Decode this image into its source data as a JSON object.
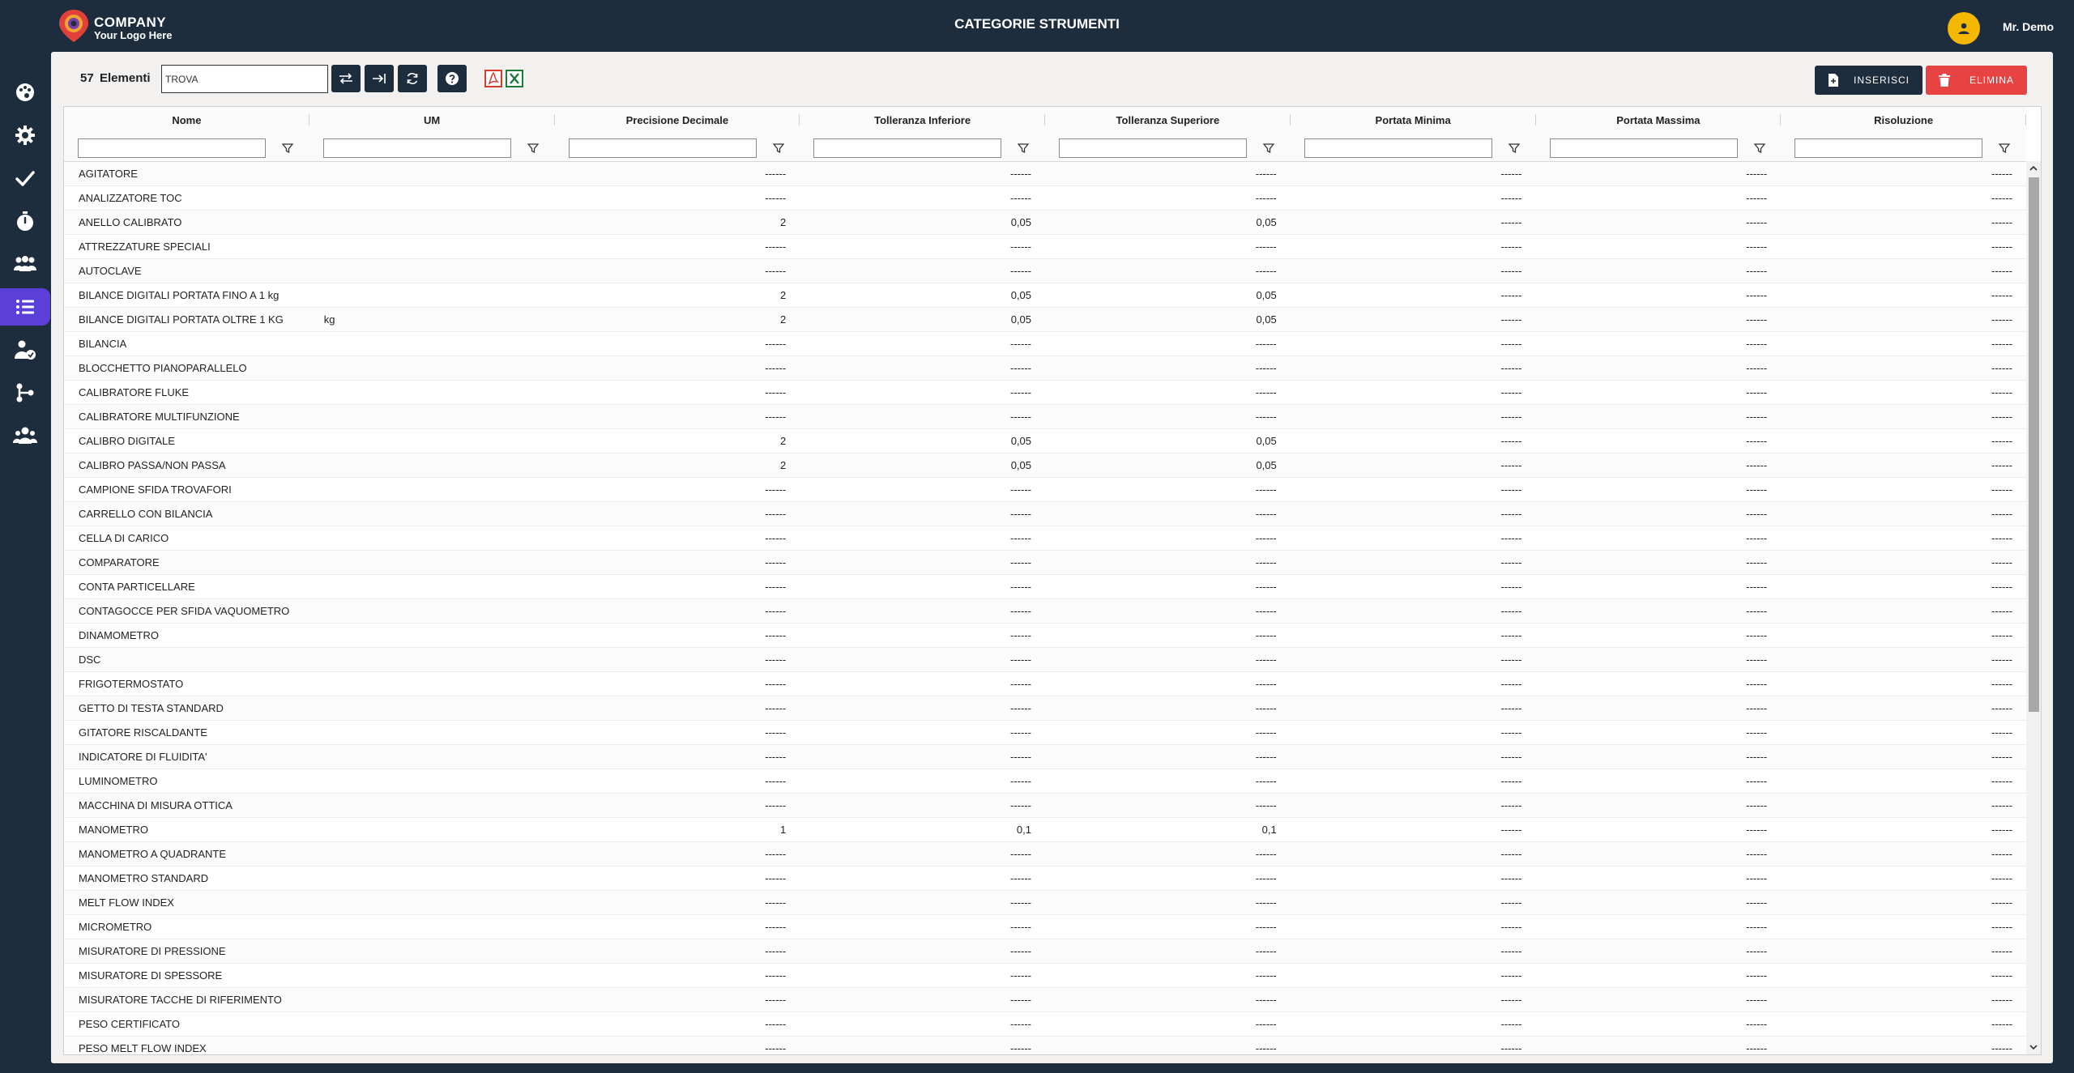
{
  "header": {
    "company": "COMPANY",
    "tagline": "Your Logo Here",
    "title": "CATEGORIE STRUMENTI",
    "user_name": "Mr. Demo"
  },
  "sidebar": {
    "items": [
      {
        "name": "palette-icon"
      },
      {
        "name": "gear-icon"
      },
      {
        "name": "check-icon"
      },
      {
        "name": "stopwatch-icon"
      },
      {
        "name": "users-group-icon"
      },
      {
        "name": "list-icon",
        "active": true
      },
      {
        "name": "user-check-icon"
      },
      {
        "name": "branch-icon"
      },
      {
        "name": "team-icon"
      }
    ]
  },
  "toolbar": {
    "count": "57",
    "count_label": "Elementi",
    "search_value": "TROVA",
    "insert_label": "INSERISCI",
    "delete_label": "ELIMINA"
  },
  "colors": {
    "navy": "#1e2d3d",
    "accent": "#5b3fd9",
    "danger": "#e84343",
    "avatar": "#f5b800"
  },
  "table": {
    "columns": [
      "Nome",
      "UM",
      "Precisione Decimale",
      "Tolleranza Inferiore",
      "Tolleranza Superiore",
      "Portata Minima",
      "Portata Massima",
      "Risoluzione"
    ],
    "rows": [
      [
        "AGITATORE",
        "",
        "------",
        "------",
        "------",
        "------",
        "------",
        "------"
      ],
      [
        "ANALIZZATORE TOC",
        "",
        "------",
        "------",
        "------",
        "------",
        "------",
        "------"
      ],
      [
        "ANELLO CALIBRATO",
        "",
        "2",
        "0,05",
        "0,05",
        "------",
        "------",
        "------"
      ],
      [
        "ATTREZZATURE SPECIALI",
        "",
        "------",
        "------",
        "------",
        "------",
        "------",
        "------"
      ],
      [
        "AUTOCLAVE",
        "",
        "------",
        "------",
        "------",
        "------",
        "------",
        "------"
      ],
      [
        "BILANCE DIGITALI PORTATA FINO A 1 kg",
        "",
        "2",
        "0,05",
        "0,05",
        "------",
        "------",
        "------"
      ],
      [
        "BILANCE DIGITALI PORTATA OLTRE 1 KG",
        "kg",
        "2",
        "0,05",
        "0,05",
        "------",
        "------",
        "------"
      ],
      [
        "BILANCIA",
        "",
        "------",
        "------",
        "------",
        "------",
        "------",
        "------"
      ],
      [
        "BLOCCHETTO PIANOPARALLELO",
        "",
        "------",
        "------",
        "------",
        "------",
        "------",
        "------"
      ],
      [
        "CALIBRATORE FLUKE",
        "",
        "------",
        "------",
        "------",
        "------",
        "------",
        "------"
      ],
      [
        "CALIBRATORE MULTIFUNZIONE",
        "",
        "------",
        "------",
        "------",
        "------",
        "------",
        "------"
      ],
      [
        "CALIBRO DIGITALE",
        "",
        "2",
        "0,05",
        "0,05",
        "------",
        "------",
        "------"
      ],
      [
        "CALIBRO PASSA/NON PASSA",
        "",
        "2",
        "0,05",
        "0,05",
        "------",
        "------",
        "------"
      ],
      [
        "CAMPIONE SFIDA TROVAFORI",
        "",
        "------",
        "------",
        "------",
        "------",
        "------",
        "------"
      ],
      [
        "CARRELLO CON BILANCIA",
        "",
        "------",
        "------",
        "------",
        "------",
        "------",
        "------"
      ],
      [
        "CELLA DI CARICO",
        "",
        "------",
        "------",
        "------",
        "------",
        "------",
        "------"
      ],
      [
        "COMPARATORE",
        "",
        "------",
        "------",
        "------",
        "------",
        "------",
        "------"
      ],
      [
        "CONTA PARTICELLARE",
        "",
        "------",
        "------",
        "------",
        "------",
        "------",
        "------"
      ],
      [
        "CONTAGOCCE PER SFIDA VAQUOMETRO",
        "",
        "------",
        "------",
        "------",
        "------",
        "------",
        "------"
      ],
      [
        "DINAMOMETRO",
        "",
        "------",
        "------",
        "------",
        "------",
        "------",
        "------"
      ],
      [
        "DSC",
        "",
        "------",
        "------",
        "------",
        "------",
        "------",
        "------"
      ],
      [
        "FRIGOTERMOSTATO",
        "",
        "------",
        "------",
        "------",
        "------",
        "------",
        "------"
      ],
      [
        "GETTO DI TESTA STANDARD",
        "",
        "------",
        "------",
        "------",
        "------",
        "------",
        "------"
      ],
      [
        "GITATORE RISCALDANTE",
        "",
        "------",
        "------",
        "------",
        "------",
        "------",
        "------"
      ],
      [
        "INDICATORE DI FLUIDITA'",
        "",
        "------",
        "------",
        "------",
        "------",
        "------",
        "------"
      ],
      [
        "LUMINOMETRO",
        "",
        "------",
        "------",
        "------",
        "------",
        "------",
        "------"
      ],
      [
        "MACCHINA DI MISURA OTTICA",
        "",
        "------",
        "------",
        "------",
        "------",
        "------",
        "------"
      ],
      [
        "MANOMETRO",
        "",
        "1",
        "0,1",
        "0,1",
        "------",
        "------",
        "------"
      ],
      [
        "MANOMETRO A QUADRANTE",
        "",
        "------",
        "------",
        "------",
        "------",
        "------",
        "------"
      ],
      [
        "MANOMETRO STANDARD",
        "",
        "------",
        "------",
        "------",
        "------",
        "------",
        "------"
      ],
      [
        "MELT FLOW INDEX",
        "",
        "------",
        "------",
        "------",
        "------",
        "------",
        "------"
      ],
      [
        "MICROMETRO",
        "",
        "------",
        "------",
        "------",
        "------",
        "------",
        "------"
      ],
      [
        "MISURATORE DI PRESSIONE",
        "",
        "------",
        "------",
        "------",
        "------",
        "------",
        "------"
      ],
      [
        "MISURATORE DI SPESSORE",
        "",
        "------",
        "------",
        "------",
        "------",
        "------",
        "------"
      ],
      [
        "MISURATORE TACCHE DI RIFERIMENTO",
        "",
        "------",
        "------",
        "------",
        "------",
        "------",
        "------"
      ],
      [
        "PESO CERTIFICATO",
        "",
        "------",
        "------",
        "------",
        "------",
        "------",
        "------"
      ],
      [
        "PESO MELT FLOW INDEX",
        "",
        "------",
        "------",
        "------",
        "------",
        "------",
        "------"
      ]
    ]
  }
}
